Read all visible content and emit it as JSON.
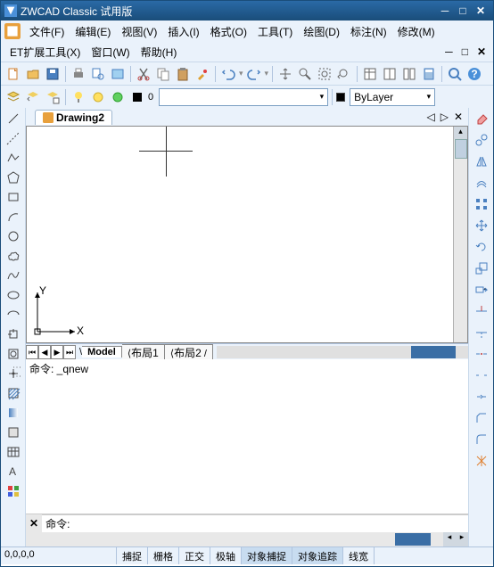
{
  "title": "ZWCAD Classic 试用版",
  "menu": [
    "文件(F)",
    "编辑(E)",
    "视图(V)",
    "插入(I)",
    "格式(O)",
    "工具(T)",
    "绘图(D)",
    "标注(N)",
    "修改(M)"
  ],
  "menu2": [
    "ET扩展工具(X)",
    "窗口(W)",
    "帮助(H)"
  ],
  "doctab": "Drawing2",
  "layer_dropdown": "",
  "linetype_dropdown": "ByLayer",
  "layout_tabs": {
    "model": "Model",
    "l1": "布局1",
    "l2": "布局2"
  },
  "cmd_output": "命令: _qnew",
  "cmd_prompt": "命令:",
  "coords": "0,0,0,0",
  "status_buttons": [
    "捕捉",
    "栅格",
    "正交",
    "极轴",
    "对象捕捉",
    "对象追踪",
    "线宽"
  ],
  "status_active": [
    4,
    5
  ],
  "ucs": {
    "x": "X",
    "y": "Y"
  },
  "icons": {
    "new": "new-icon",
    "open": "open-icon",
    "save": "save-icon",
    "print": "print-icon",
    "cut": "cut-icon",
    "copy": "copy-icon",
    "paste": "paste-icon",
    "erase": "erase-icon",
    "undo": "undo-icon",
    "redo": "redo-icon",
    "pan": "pan-icon",
    "zoom": "zoom-icon",
    "help": "help-icon",
    "search": "search-icon"
  }
}
